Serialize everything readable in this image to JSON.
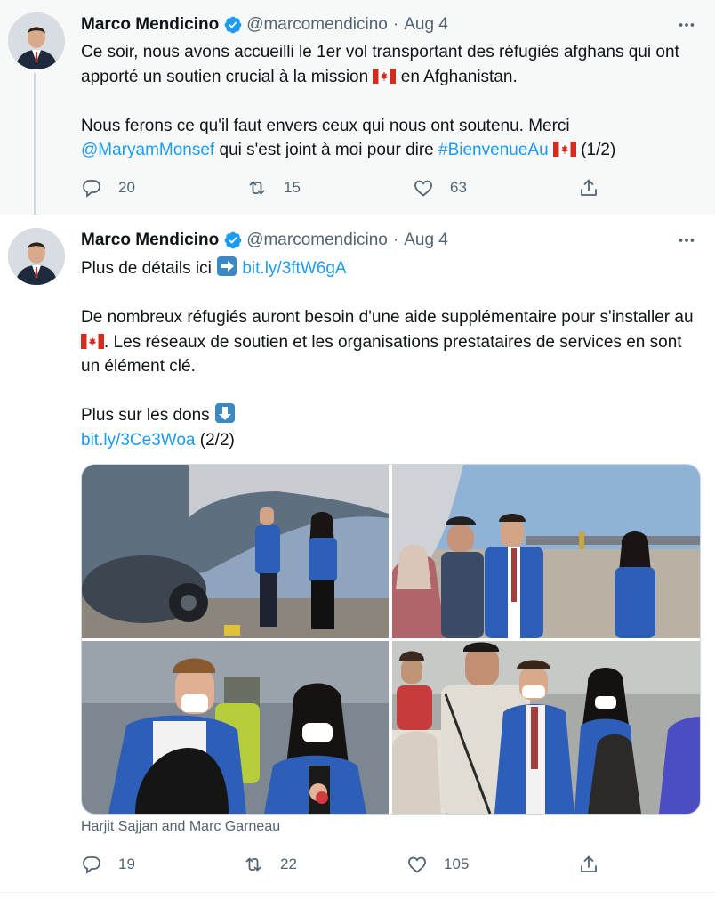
{
  "tweets": [
    {
      "author_name": "Marco Mendicino",
      "handle": "@marcomendicino",
      "separator": "·",
      "date": "Aug 4",
      "p1_a": "Ce soir, nous avons accueilli le 1er vol transportant des réfugiés afghans qui ont apporté un soutien crucial à la mission ",
      "p1_b": " en Afghanistan.",
      "p2_a": "Nous ferons ce qu'il faut envers ceux qui nous ont soutenu. Merci ",
      "mention": "@MaryamMonsef",
      "p2_b": " qui s'est joint à moi pour dire ",
      "hashtag": "#BienvenueAu",
      "p2_c": " (1/2)",
      "replies": "20",
      "retweets": "15",
      "likes": "63"
    },
    {
      "author_name": "Marco Mendicino",
      "handle": "@marcomendicino",
      "separator": "·",
      "date": "Aug 4",
      "p1_a": "Plus de détails ici ",
      "link1": "bit.ly/3ftW6gA",
      "p2_a": "De nombreux réfugiés auront besoin d'une aide supplémentaire pour s'installer au ",
      "p2_b": ". Les réseaux de soutien et les organisations prestataires de services en sont un élément clé.",
      "p3_a": "Plus sur les dons ",
      "link2": "bit.ly/3Ce3Woa",
      "p3_b": " (2/2)",
      "photo_caption": "Harjit Sajjan and Marc Garneau",
      "replies": "19",
      "retweets": "22",
      "likes": "105"
    }
  ],
  "icons": {
    "verified": "verified-badge-icon",
    "more": "more-options-icon",
    "reply": "reply-icon",
    "retweet": "retweet-icon",
    "like": "like-heart-icon",
    "share": "share-icon",
    "flag": "canada-flag-emoji",
    "right_arrow": "right-arrow-emoji",
    "down_arrow": "down-arrow-emoji"
  },
  "colors": {
    "accent": "#1d9bf0",
    "secondary_text": "#536471",
    "thread_background": "#f7f9f9"
  }
}
